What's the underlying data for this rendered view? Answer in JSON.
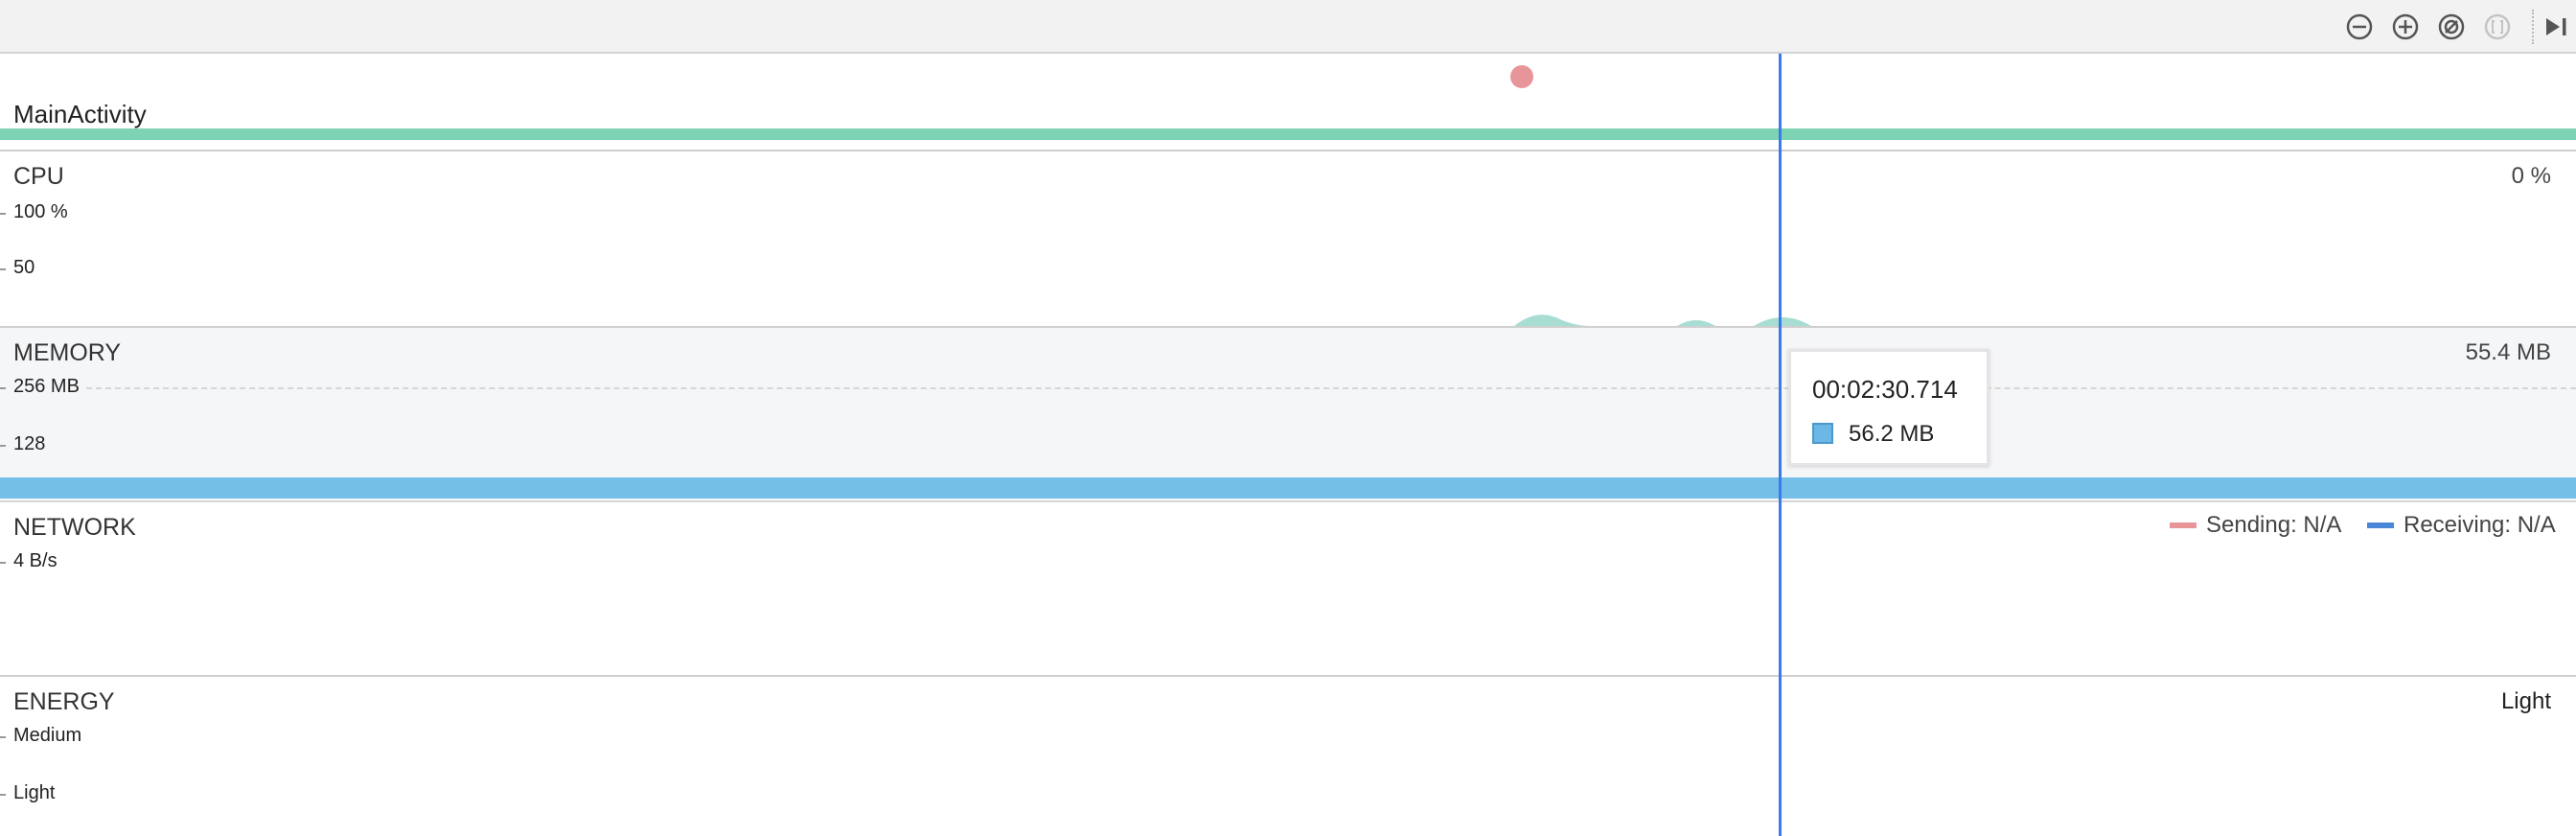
{
  "toolbar": {
    "buttons": [
      {
        "name": "zoom-out-button",
        "icon": "minus-circle-icon"
      },
      {
        "name": "zoom-in-button",
        "icon": "plus-circle-icon"
      },
      {
        "name": "reset-zoom-button",
        "icon": "reset-circle-icon"
      },
      {
        "name": "zoom-to-selection-button",
        "icon": "bracket-circle-icon",
        "disabled": true
      },
      {
        "name": "go-live-button",
        "icon": "play-to-end-icon"
      }
    ]
  },
  "activity": {
    "label": "MainActivity",
    "bar_color": "#7dd3b4",
    "event_dot_color": "#e8959a"
  },
  "cpu": {
    "title": "CPU",
    "ticks": [
      "100 %",
      "50"
    ],
    "current_value": "0 %",
    "area_color": "#a8ddd3"
  },
  "memory": {
    "title": "MEMORY",
    "ticks": [
      "256 MB",
      "128"
    ],
    "current_value": "55.4 MB",
    "bar_color": "#74bfe8"
  },
  "network": {
    "title": "NETWORK",
    "ticks": [
      "4 B/s"
    ],
    "legend": [
      {
        "label": "Sending: N/A",
        "color": "#e8959a"
      },
      {
        "label": "Receiving: N/A",
        "color": "#4a86d6"
      }
    ]
  },
  "energy": {
    "title": "ENERGY",
    "ticks": [
      "Medium",
      "Light"
    ],
    "current_value": "Light"
  },
  "tooltip": {
    "time": "00:02:30.714",
    "value": "56.2 MB",
    "swatch_color": "#6bb8e6"
  },
  "cursor": {
    "color": "#3b7be8"
  }
}
